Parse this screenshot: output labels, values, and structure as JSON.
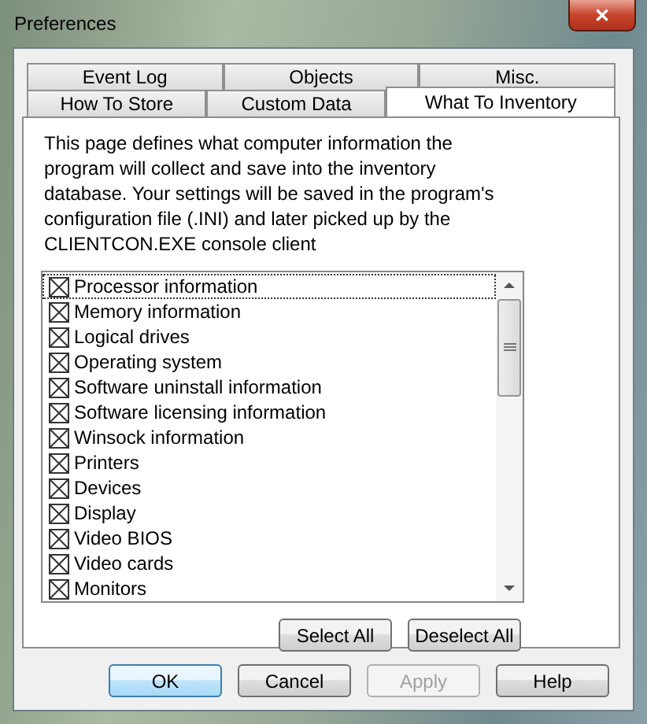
{
  "window": {
    "title": "Preferences",
    "close": "✕"
  },
  "tab_rows": [
    {
      "tabs": [
        {
          "label": "Event Log",
          "selected": false
        },
        {
          "label": "Objects",
          "selected": false
        },
        {
          "label": "Misc.",
          "selected": false
        }
      ]
    },
    {
      "tabs": [
        {
          "label": "How To Store",
          "selected": false
        },
        {
          "label": "Custom Data",
          "selected": false
        },
        {
          "label": "What To Inventory",
          "selected": true
        }
      ]
    }
  ],
  "description": "This page defines what computer information the program will collect and save into the inventory database. Your settings will be saved in the program's configuration file (.INI) and later picked up by the CLIENTCON.EXE console client",
  "items": [
    {
      "label": "Processor information",
      "checked": true,
      "focused": true
    },
    {
      "label": "Memory information",
      "checked": true,
      "focused": false
    },
    {
      "label": "Logical drives",
      "checked": true,
      "focused": false
    },
    {
      "label": "Operating system",
      "checked": true,
      "focused": false
    },
    {
      "label": "Software uninstall information",
      "checked": true,
      "focused": false
    },
    {
      "label": "Software licensing information",
      "checked": true,
      "focused": false
    },
    {
      "label": "Winsock information",
      "checked": true,
      "focused": false
    },
    {
      "label": "Printers",
      "checked": true,
      "focused": false
    },
    {
      "label": "Devices",
      "checked": true,
      "focused": false
    },
    {
      "label": "Display",
      "checked": true,
      "focused": false
    },
    {
      "label": "Video BIOS",
      "checked": true,
      "focused": false
    },
    {
      "label": "Video cards",
      "checked": true,
      "focused": false
    },
    {
      "label": "Monitors",
      "checked": true,
      "focused": false
    }
  ],
  "list_buttons": [
    {
      "label": "Select All"
    },
    {
      "label": "Deselect All"
    }
  ],
  "dialog_buttons": [
    {
      "label": "OK",
      "default": true,
      "disabled": false
    },
    {
      "label": "Cancel",
      "default": false,
      "disabled": false
    },
    {
      "label": "Apply",
      "default": false,
      "disabled": true
    },
    {
      "label": "Help",
      "default": false,
      "disabled": false
    }
  ]
}
